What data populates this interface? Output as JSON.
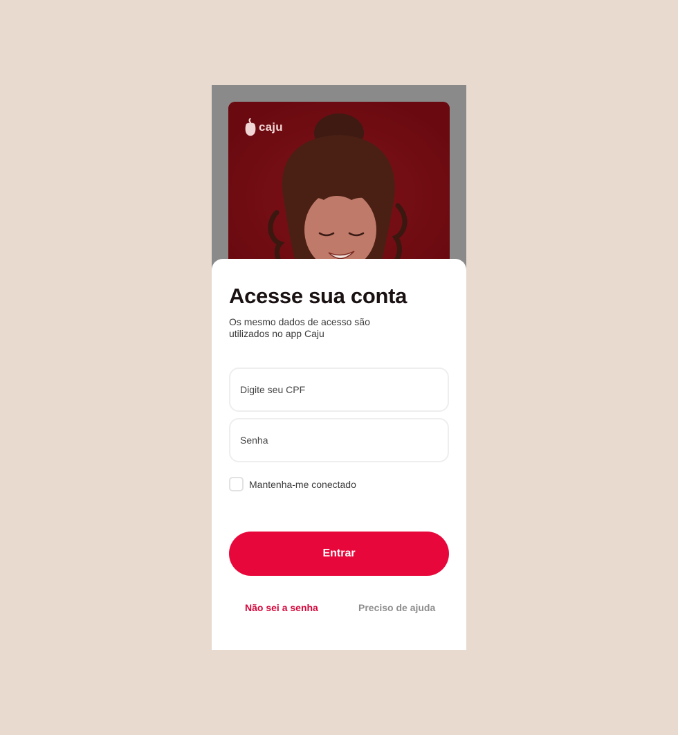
{
  "brand": {
    "logo_text": "caju",
    "logo_icon": "cashew-icon",
    "accent_color": "#e8073a"
  },
  "hero": {
    "image": "smiling-woman-photo"
  },
  "login": {
    "title": "Acesse sua conta",
    "subtitle": "Os mesmo dados de acesso são utilizados no app Caju",
    "cpf_placeholder": "Digite seu CPF",
    "password_placeholder": "Senha",
    "remember_label": "Mantenha-me conectado",
    "remember_checked": false,
    "submit_label": "Entrar",
    "forgot_password_label": "Não sei a senha",
    "help_label": "Preciso de ajuda"
  }
}
